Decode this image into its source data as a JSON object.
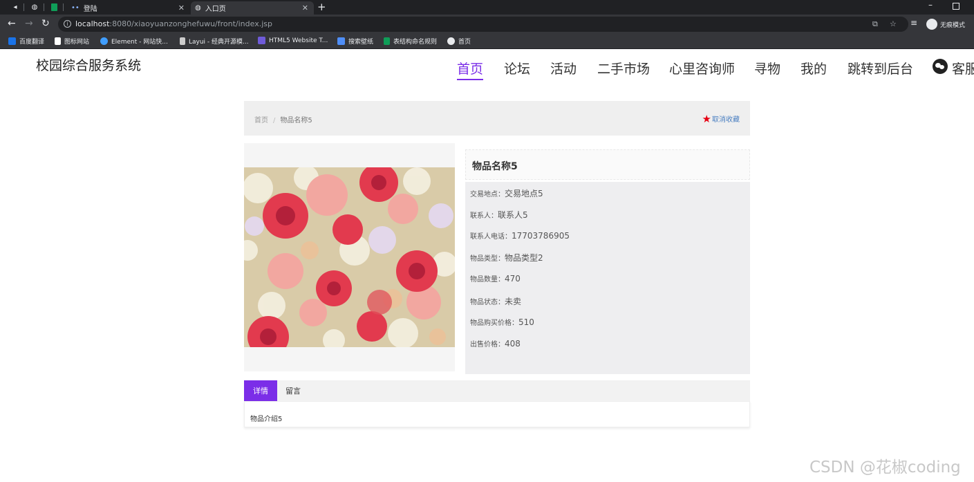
{
  "browser": {
    "tabs": [
      {
        "label": "",
        "icon": "globe-icon"
      },
      {
        "label": "",
        "icon": "sheet-icon"
      },
      {
        "label": "登陆",
        "icon": "dots-icon"
      },
      {
        "label": "入口页",
        "icon": "globe-icon",
        "active": true
      }
    ],
    "url_host": "localhost",
    "url_rest": ":8080/xiaoyuanzonghefuwu/front/index.jsp",
    "incognito_label": "无痕模式",
    "bookmarks": [
      {
        "label": "百度翻译",
        "color": "#1a73e8"
      },
      {
        "label": "图标网站",
        "color": "#ffffff"
      },
      {
        "label": "Element - 网站快...",
        "color": "#409eff"
      },
      {
        "label": "Layui - 经典开源模...",
        "color": "#cccccc"
      },
      {
        "label": "HTML5 Website T...",
        "color": "#6f5bd9"
      },
      {
        "label": "搜索壁纸",
        "color": "#4f8ef7"
      },
      {
        "label": "表结构命名规则",
        "color": "#0f9d58"
      },
      {
        "label": "首页",
        "color": "#e8eaed"
      }
    ]
  },
  "site": {
    "title": "校园综合服务系统",
    "nav": [
      "首页",
      "论坛",
      "活动",
      "二手市场",
      "心里咨询师",
      "寻物",
      "我的",
      "跳转到后台"
    ],
    "service_label": "客服",
    "accent": "#7b2ee8"
  },
  "breadcrumb": {
    "home": "首页",
    "separator": "/",
    "current": "物品名称5"
  },
  "favorite": {
    "label": "取消收藏"
  },
  "item": {
    "title": "物品名称5",
    "fields": [
      {
        "label": "交易地点：",
        "value": "交易地点5"
      },
      {
        "label": "联系人：",
        "value": "联系人5"
      },
      {
        "label": "联系人电话：",
        "value": "17703786905"
      },
      {
        "label": "物品类型：",
        "value": "物品类型2"
      },
      {
        "label": "物品数量：",
        "value": "470"
      },
      {
        "label": "物品状态：",
        "value": "未卖"
      },
      {
        "label": "物品购买价格：",
        "value": "510"
      },
      {
        "label": "出售价格：",
        "value": "408"
      }
    ]
  },
  "detail_tabs": {
    "details": "详情",
    "comments": "留言"
  },
  "description": "物品介绍5",
  "watermark": "CSDN @花椒coding"
}
